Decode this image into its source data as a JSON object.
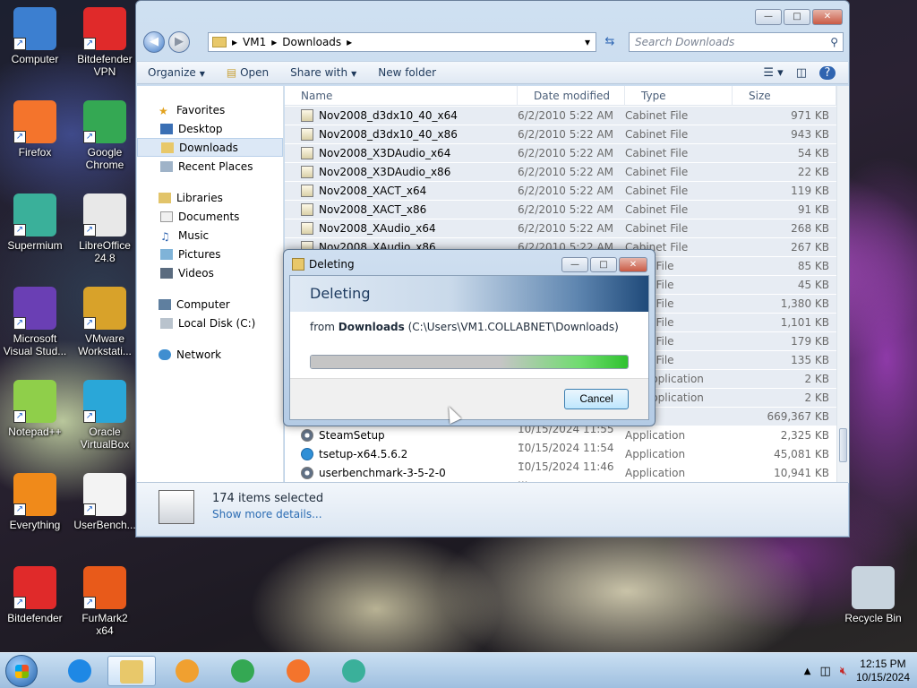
{
  "desktop": {
    "icons": [
      {
        "label": "Computer",
        "icon": "computer-icon",
        "color": "#3c7fd0"
      },
      {
        "label": "Bitdefender VPN",
        "icon": "bitdefender-vpn-icon",
        "color": "#e02a2a"
      },
      {
        "label": "Firefox",
        "icon": "firefox-icon",
        "color": "#f4742c"
      },
      {
        "label": "Google Chrome",
        "icon": "chrome-icon",
        "color": "#34a853"
      },
      {
        "label": "Supermium",
        "icon": "supermium-icon",
        "color": "#3ab09a"
      },
      {
        "label": "LibreOffice 24.8",
        "icon": "libreoffice-icon",
        "color": "#e8e8e8"
      },
      {
        "label": "Microsoft Visual Stud...",
        "icon": "visual-studio-icon",
        "color": "#6a3fb4"
      },
      {
        "label": "VMware Workstati...",
        "icon": "vmware-icon",
        "color": "#d8a22a"
      },
      {
        "label": "Notepad++",
        "icon": "notepadpp-icon",
        "color": "#8fcf4a"
      },
      {
        "label": "Oracle VirtualBox",
        "icon": "virtualbox-icon",
        "color": "#2aa7d8"
      },
      {
        "label": "Everything",
        "icon": "everything-icon",
        "color": "#f08a1a"
      },
      {
        "label": "UserBench...",
        "icon": "userbenchmark-icon",
        "color": "#f3f3f3"
      },
      {
        "label": "Bitdefender",
        "icon": "bitdefender-icon",
        "color": "#e02a2a"
      },
      {
        "label": "FurMark2 x64",
        "icon": "furmark-icon",
        "color": "#e85a1a"
      },
      {
        "label": "Recycle Bin",
        "icon": "recycle-bin-icon",
        "color": "#c8d4de"
      }
    ]
  },
  "explorer": {
    "breadcrumb": [
      "VM1",
      "Downloads"
    ],
    "search_placeholder": "Search Downloads",
    "toolbar": {
      "organize": "Organize",
      "open": "Open",
      "share_with": "Share with",
      "new_folder": "New folder"
    },
    "nav": {
      "favorites": "Favorites",
      "favorites_items": [
        "Desktop",
        "Downloads",
        "Recent Places"
      ],
      "libraries": "Libraries",
      "libraries_items": [
        "Documents",
        "Music",
        "Pictures",
        "Videos"
      ],
      "computer": "Computer",
      "computer_items": [
        "Local Disk (C:)"
      ],
      "network": "Network"
    },
    "columns": {
      "name": "Name",
      "date": "Date modified",
      "type": "Type",
      "size": "Size"
    },
    "files": [
      {
        "name": "Nov2008_d3dx10_40_x64",
        "date": "6/2/2010 5:22 AM",
        "type": "Cabinet File",
        "size": "971 KB",
        "icon": "cabinet"
      },
      {
        "name": "Nov2008_d3dx10_40_x86",
        "date": "6/2/2010 5:22 AM",
        "type": "Cabinet File",
        "size": "943 KB",
        "icon": "cabinet"
      },
      {
        "name": "Nov2008_X3DAudio_x64",
        "date": "6/2/2010 5:22 AM",
        "type": "Cabinet File",
        "size": "54 KB",
        "icon": "cabinet"
      },
      {
        "name": "Nov2008_X3DAudio_x86",
        "date": "6/2/2010 5:22 AM",
        "type": "Cabinet File",
        "size": "22 KB",
        "icon": "cabinet"
      },
      {
        "name": "Nov2008_XACT_x64",
        "date": "6/2/2010 5:22 AM",
        "type": "Cabinet File",
        "size": "119 KB",
        "icon": "cabinet"
      },
      {
        "name": "Nov2008_XACT_x86",
        "date": "6/2/2010 5:22 AM",
        "type": "Cabinet File",
        "size": "91 KB",
        "icon": "cabinet"
      },
      {
        "name": "Nov2008_XAudio_x64",
        "date": "6/2/2010 5:22 AM",
        "type": "Cabinet File",
        "size": "268 KB",
        "icon": "cabinet"
      },
      {
        "name": "Nov2008_XAudio_x86",
        "date": "6/2/2010 5:22 AM",
        "type": "Cabinet File",
        "size": "267 KB",
        "icon": "cabinet"
      },
      {
        "name": "",
        "date": "",
        "type": "binet File",
        "size": "85 KB",
        "icon": "cabinet"
      },
      {
        "name": "",
        "date": "",
        "type": "binet File",
        "size": "45 KB",
        "icon": "cabinet"
      },
      {
        "name": "",
        "date": "",
        "type": "binet File",
        "size": "1,380 KB",
        "icon": "cabinet"
      },
      {
        "name": "",
        "date": "",
        "type": "binet File",
        "size": "1,101 KB",
        "icon": "cabinet"
      },
      {
        "name": "",
        "date": "",
        "type": "binet File",
        "size": "179 KB",
        "icon": "cabinet"
      },
      {
        "name": "",
        "date": "",
        "type": "binet File",
        "size": "135 KB",
        "icon": "cabinet"
      },
      {
        "name": "",
        "date": "",
        "type": "ML Application",
        "size": "2 KB",
        "icon": "cabinet"
      },
      {
        "name": "",
        "date": "",
        "type": "ML Application",
        "size": "2 KB",
        "icon": "cabinet"
      },
      {
        "name": "",
        "date": "",
        "type": "File",
        "size": "669,367 KB",
        "icon": "cabinet"
      },
      {
        "name": "SteamSetup",
        "date": "10/15/2024 11:55 ...",
        "type": "Application",
        "size": "2,325 KB",
        "icon": "app"
      },
      {
        "name": "tsetup-x64.5.6.2",
        "date": "10/15/2024 11:54 ...",
        "type": "Application",
        "size": "45,081 KB",
        "icon": "tg"
      },
      {
        "name": "userbenchmark-3-5-2-0",
        "date": "10/15/2024 11:46 ...",
        "type": "Application",
        "size": "10,941 KB",
        "icon": "app"
      }
    ],
    "details": {
      "selected": "174 items selected",
      "more": "Show more details..."
    }
  },
  "dialog": {
    "title": "Deleting",
    "heading": "Deleting",
    "from_prefix": "from",
    "from_folder": "Downloads",
    "from_path": "(C:\\Users\\VM1.COLLABNET\\Downloads)",
    "progress": 1.0,
    "cancel": "Cancel"
  },
  "taskbar": {
    "apps": [
      "internet-explorer-icon",
      "explorer-icon",
      "media-player-icon",
      "chrome-icon",
      "firefox-icon",
      "supermium-icon"
    ],
    "time": "12:15 PM",
    "date": "10/15/2024"
  }
}
